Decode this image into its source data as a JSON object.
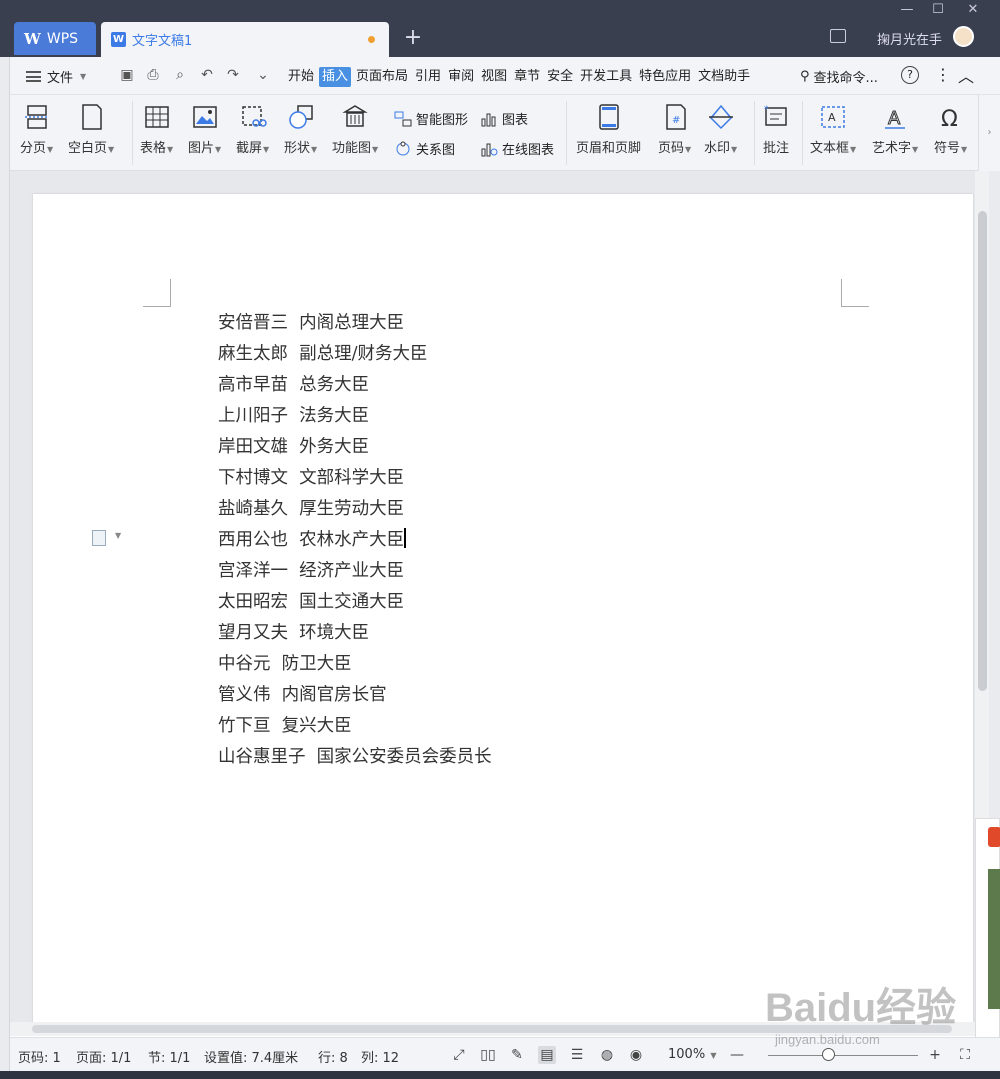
{
  "titlebar": {
    "app_tab": "WPS",
    "doc_tab": "文字文稿1",
    "doc_icon": "W",
    "new_tab": "+",
    "user_name": "掬月光在手",
    "minimize": "—",
    "maximize": "☐",
    "close": "✕"
  },
  "menubar": {
    "file": "文件",
    "tabs": [
      "开始",
      "插入",
      "页面布局",
      "引用",
      "审阅",
      "视图",
      "章节",
      "安全",
      "开发工具",
      "特色应用",
      "文档助手"
    ],
    "active_tab": "插入",
    "find": "查找命令...",
    "help": "?"
  },
  "ribbon": {
    "page_break": "分页",
    "blank_page": "空白页",
    "table": "表格",
    "picture": "图片",
    "screenshot": "截屏",
    "shapes": "形状",
    "function_chart": "功能图",
    "smart_art": "智能图形",
    "chart": "图表",
    "relation_chart": "关系图",
    "online_chart": "在线图表",
    "header_footer": "页眉和页脚",
    "page_number": "页码",
    "watermark": "水印",
    "comment": "批注",
    "text_box": "文本框",
    "word_art": "艺术字",
    "symbol": "符号"
  },
  "document": {
    "lines": [
      "安倍晋三  内阁总理大臣",
      "麻生太郎  副总理/财务大臣",
      "高市早苗  总务大臣",
      "上川阳子  法务大臣",
      "岸田文雄  外务大臣",
      "下村博文  文部科学大臣",
      "盐崎基久  厚生劳动大臣",
      "西用公也  农林水产大臣",
      "宫泽洋一  经济产业大臣",
      "太田昭宏  国土交通大臣",
      "望月又夫  环境大臣",
      "中谷元  防卫大臣",
      "管义伟  内阁官房长官",
      "竹下亘  复兴大臣",
      "山谷惠里子  国家公安委员会委员长"
    ]
  },
  "statusbar": {
    "page_code": "页码: 1",
    "page": "页面: 1/1",
    "section": "节: 1/1",
    "setting": "设置值: 7.4厘米",
    "row": "行: 8",
    "col": "列: 12",
    "zoom": "100%",
    "zoom_level": 0.4
  },
  "watermark": {
    "brand": "Baidu经验",
    "url": "jingyan.baidu.com"
  }
}
